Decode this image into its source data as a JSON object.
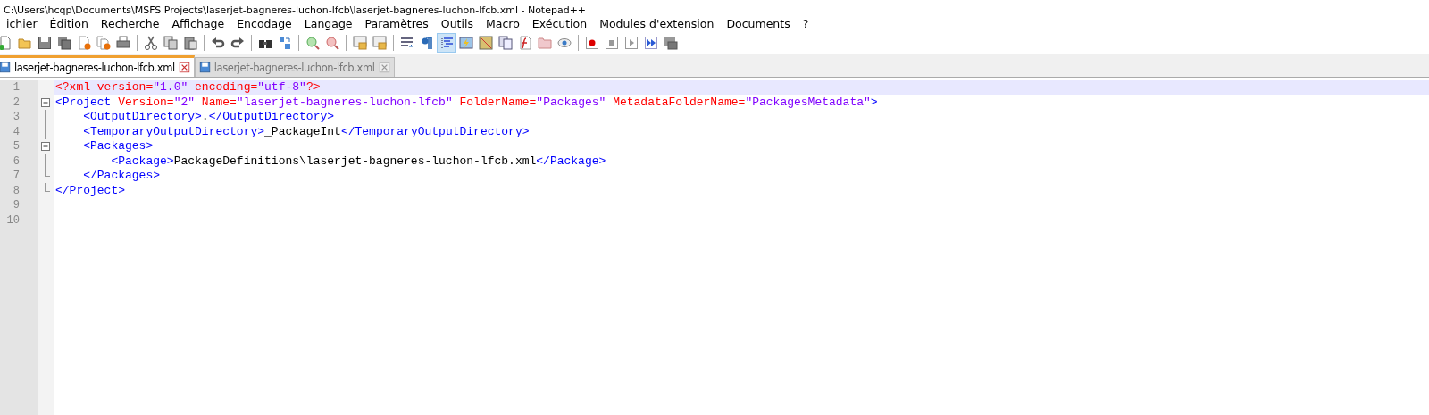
{
  "window": {
    "title": "C:\\Users\\hcqp\\Documents\\MSFS Projects\\laserjet-bagneres-luchon-lfcb\\laserjet-bagneres-luchon-lfcb.xml - Notepad++"
  },
  "menu": [
    "ichier",
    "Édition",
    "Recherche",
    "Affichage",
    "Encodage",
    "Langage",
    "Paramètres",
    "Outils",
    "Macro",
    "Exécution",
    "Modules d'extension",
    "Documents",
    "?"
  ],
  "toolbar": [
    {
      "kind": "button",
      "selected": false
    },
    {
      "kind": "button",
      "selected": false
    },
    {
      "kind": "button",
      "selected": false
    },
    {
      "kind": "button",
      "selected": false
    },
    {
      "kind": "button",
      "selected": false
    },
    {
      "kind": "button",
      "selected": false
    },
    {
      "kind": "button",
      "selected": false
    },
    {
      "kind": "separator"
    },
    {
      "kind": "button",
      "selected": false
    },
    {
      "kind": "button",
      "selected": false
    },
    {
      "kind": "button",
      "selected": false
    },
    {
      "kind": "separator"
    },
    {
      "kind": "button",
      "selected": false
    },
    {
      "kind": "button",
      "selected": false
    },
    {
      "kind": "separator"
    },
    {
      "kind": "button",
      "selected": false
    },
    {
      "kind": "button",
      "selected": false
    },
    {
      "kind": "separator"
    },
    {
      "kind": "button",
      "selected": false
    },
    {
      "kind": "button",
      "selected": false
    },
    {
      "kind": "separator"
    },
    {
      "kind": "button",
      "selected": false
    },
    {
      "kind": "button",
      "selected": false
    },
    {
      "kind": "separator"
    },
    {
      "kind": "button",
      "selected": false
    },
    {
      "kind": "button",
      "selected": false
    },
    {
      "kind": "button",
      "selected": true
    },
    {
      "kind": "button",
      "selected": false
    },
    {
      "kind": "button",
      "selected": false
    },
    {
      "kind": "button",
      "selected": false
    },
    {
      "kind": "button",
      "selected": false
    },
    {
      "kind": "button",
      "selected": false
    },
    {
      "kind": "button",
      "selected": false
    },
    {
      "kind": "separator"
    },
    {
      "kind": "button",
      "selected": false
    },
    {
      "kind": "button",
      "selected": false
    },
    {
      "kind": "button",
      "selected": false
    },
    {
      "kind": "button",
      "selected": false
    },
    {
      "kind": "button",
      "selected": false
    }
  ],
  "tabs": [
    {
      "label": "laserjet-bagneres-luchon-lfcb.xml",
      "selected": true
    },
    {
      "label": "laserjet-bagneres-luchon-lfcb.xml",
      "selected": false
    }
  ],
  "editor": {
    "lines": [
      {
        "number": "1",
        "current": true,
        "kind": "plain",
        "tokens": [
          {
            "kind": "pi",
            "text": "<?xml "
          },
          {
            "kind": "attr",
            "text": "version="
          },
          {
            "kind": "value",
            "text": "\"1.0\""
          },
          {
            "kind": "attr",
            "text": " encoding="
          },
          {
            "kind": "value",
            "text": "\"utf-8\""
          },
          {
            "kind": "pi",
            "text": "?>"
          }
        ]
      },
      {
        "number": "2",
        "current": false,
        "kind": "fold_start",
        "tokens": [
          {
            "kind": "tag",
            "text": "<Project "
          },
          {
            "kind": "attr",
            "text": "Version="
          },
          {
            "kind": "value",
            "text": "\"2\""
          },
          {
            "kind": "attr",
            "text": " Name="
          },
          {
            "kind": "value",
            "text": "\"laserjet-bagneres-luchon-lfcb\""
          },
          {
            "kind": "attr",
            "text": " FolderName="
          },
          {
            "kind": "value",
            "text": "\"Packages\""
          },
          {
            "kind": "attr",
            "text": " MetadataFolderName="
          },
          {
            "kind": "value",
            "text": "\"PackagesMetadata\""
          },
          {
            "kind": "tag",
            "text": ">"
          }
        ]
      },
      {
        "number": "3",
        "current": false,
        "kind": "fold_line",
        "tokens": [
          {
            "kind": "tag",
            "text": "    <OutputDirectory>"
          },
          {
            "kind": "text",
            "text": "."
          },
          {
            "kind": "tag",
            "text": "</OutputDirectory>"
          }
        ]
      },
      {
        "number": "4",
        "current": false,
        "kind": "fold_line",
        "tokens": [
          {
            "kind": "tag",
            "text": "    <TemporaryOutputDirectory>"
          },
          {
            "kind": "text",
            "text": "_PackageInt"
          },
          {
            "kind": "tag",
            "text": "</TemporaryOutputDirectory>"
          }
        ]
      },
      {
        "number": "5",
        "current": false,
        "kind": "fold_start",
        "tokens": [
          {
            "kind": "tag",
            "text": "    <Packages>"
          }
        ]
      },
      {
        "number": "6",
        "current": false,
        "kind": "fold_line",
        "tokens": [
          {
            "kind": "tag",
            "text": "        <Package>"
          },
          {
            "kind": "text",
            "text": "PackageDefinitions\\laserjet-bagneres-luchon-lfcb.xml"
          },
          {
            "kind": "tag",
            "text": "</Package>"
          }
        ]
      },
      {
        "number": "7",
        "current": false,
        "kind": "fold_end",
        "tokens": [
          {
            "kind": "tag",
            "text": "    </Packages>"
          }
        ]
      },
      {
        "number": "8",
        "current": false,
        "kind": "fold_end",
        "tokens": [
          {
            "kind": "tag",
            "text": "</Project>"
          }
        ]
      },
      {
        "number": "9",
        "current": false,
        "kind": "plain"
      },
      {
        "number": "10",
        "current": false,
        "kind": "plain"
      }
    ]
  }
}
